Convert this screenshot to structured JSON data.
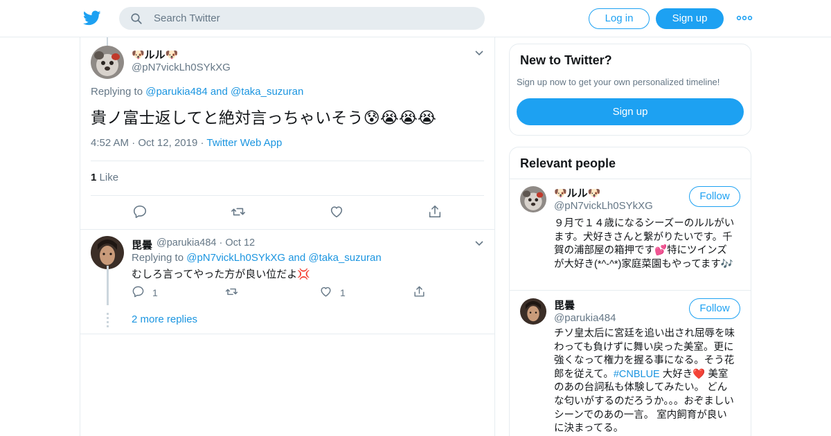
{
  "header": {
    "search_placeholder": "Search Twitter",
    "login_label": "Log in",
    "signup_label": "Sign up",
    "icons": {
      "logo": "twitter-bird-icon",
      "search": "search-icon",
      "more": "more-dots-icon"
    }
  },
  "main_tweet": {
    "display_name": "🐶ルル🐶",
    "handle": "@pN7vickLh0SYkXG",
    "replying_prefix": "Replying to",
    "replying_user1": "@parukia484",
    "replying_and": "and",
    "replying_user2": "@taka_suzuran",
    "text": "貴ノ富士返してと絶対言っちゃいそう😰😭😭😭",
    "time": "4:52 AM",
    "date": "Oct 12, 2019",
    "source": "Twitter Web App",
    "like_count": "1",
    "like_label": "Like"
  },
  "reply": {
    "display_name": "毘曇",
    "handle": "@parukia484",
    "date": "Oct 12",
    "replying_prefix": "Replying to",
    "replying_user1": "@pN7vickLh0SYkXG",
    "replying_and": "and",
    "replying_user2": "@taka_suzuran",
    "text": "むしろ言ってやった方が良い位だよ💢",
    "reply_count": "1",
    "like_count": "1",
    "more_replies": "2 more replies"
  },
  "sidebar": {
    "new_card": {
      "title": "New to Twitter?",
      "subtitle": "Sign up now to get your own personalized timeline!",
      "button": "Sign up"
    },
    "relevant": {
      "title": "Relevant people",
      "people": [
        {
          "name": "🐶ルル🐶",
          "handle": "@pN7vickLh0SYkXG",
          "follow": "Follow",
          "bio": "９月で１４歳になるシーズーのルルがいます。犬好きさんと繋がりたいです。千賀の浦部屋の箱押です💕特にツインズが大好き(*^-^*)家庭菜園もやってます🎶"
        },
        {
          "name": "毘曇",
          "handle": "@parukia484",
          "follow": "Follow",
          "bio_before": "チソ皇太后に宮廷を追い出され屈辱を味わっても負けずに舞い戻った美室。更に強くなって権力を握る事になる。そう花郎を従えて。",
          "bio_hashtag": "#CNBLUE",
          "bio_after": " 大好き❤️ 美室のあの台詞私も体験してみたい。 どんな匂いがするのだろうか。。。おぞましいシーンでのあの一言。 室内飼育が良いに決まってる。"
        }
      ]
    }
  },
  "colors": {
    "accent": "#1da1f2",
    "link": "#1b95e0",
    "text": "#14171a",
    "muted": "#657786",
    "border": "#e6ecf0"
  }
}
